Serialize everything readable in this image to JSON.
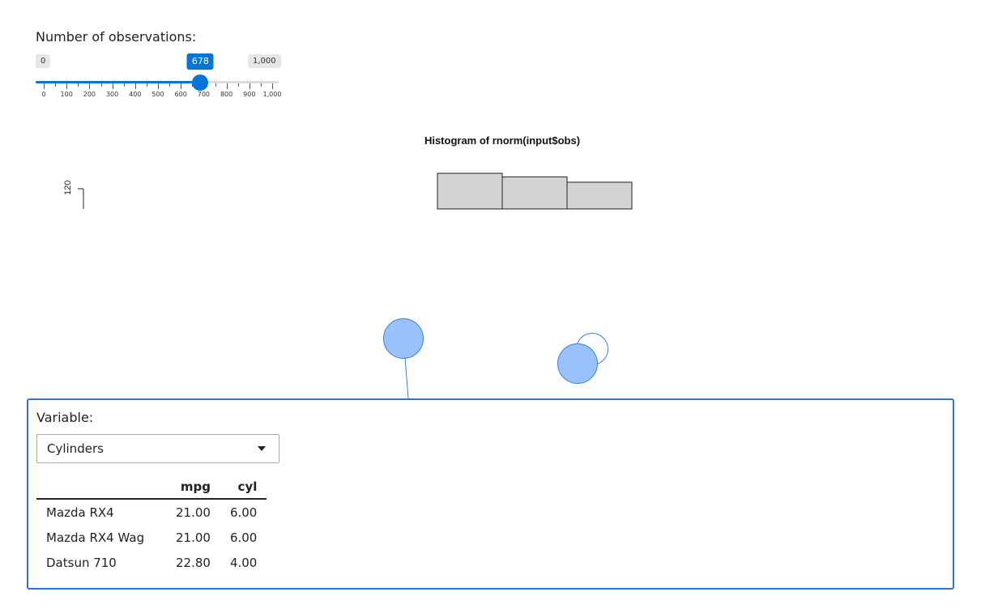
{
  "slider": {
    "label": "Number of observations:",
    "min": 0,
    "max": 1000,
    "value": 678,
    "min_label": "0",
    "max_label": "1,000",
    "value_label": "678",
    "ticks": [
      "0",
      "100",
      "200",
      "300",
      "400",
      "500",
      "600",
      "700",
      "800",
      "900",
      "1,000"
    ],
    "accent_color": "#0275d8"
  },
  "histogram": {
    "title": "Histogram of rnorm(input$obs)",
    "y_tick": "120"
  },
  "chart_data": {
    "type": "bar",
    "title": "Histogram of rnorm(input$obs)",
    "xlabel": "",
    "ylabel": "",
    "visible_y_ticks": [
      120
    ],
    "bar_fill": "#d3d3d3",
    "note_values": [
      {
        "bin": 1,
        "value": 126
      },
      {
        "bin": 2,
        "value": 122
      },
      {
        "bin": 3,
        "value": 116
      }
    ]
  },
  "variable_panel": {
    "label": "Variable:",
    "selected": "Cylinders",
    "border_color": "#2f74c8"
  },
  "table": {
    "columns": [
      "",
      "mpg",
      "cyl"
    ],
    "rows": [
      {
        "name": "Mazda RX4",
        "mpg": "21.00",
        "cyl": "6.00"
      },
      {
        "name": "Mazda RX4 Wag",
        "mpg": "21.00",
        "cyl": "6.00"
      },
      {
        "name": "Datsun 710",
        "mpg": "22.80",
        "cyl": "4.00"
      }
    ]
  }
}
